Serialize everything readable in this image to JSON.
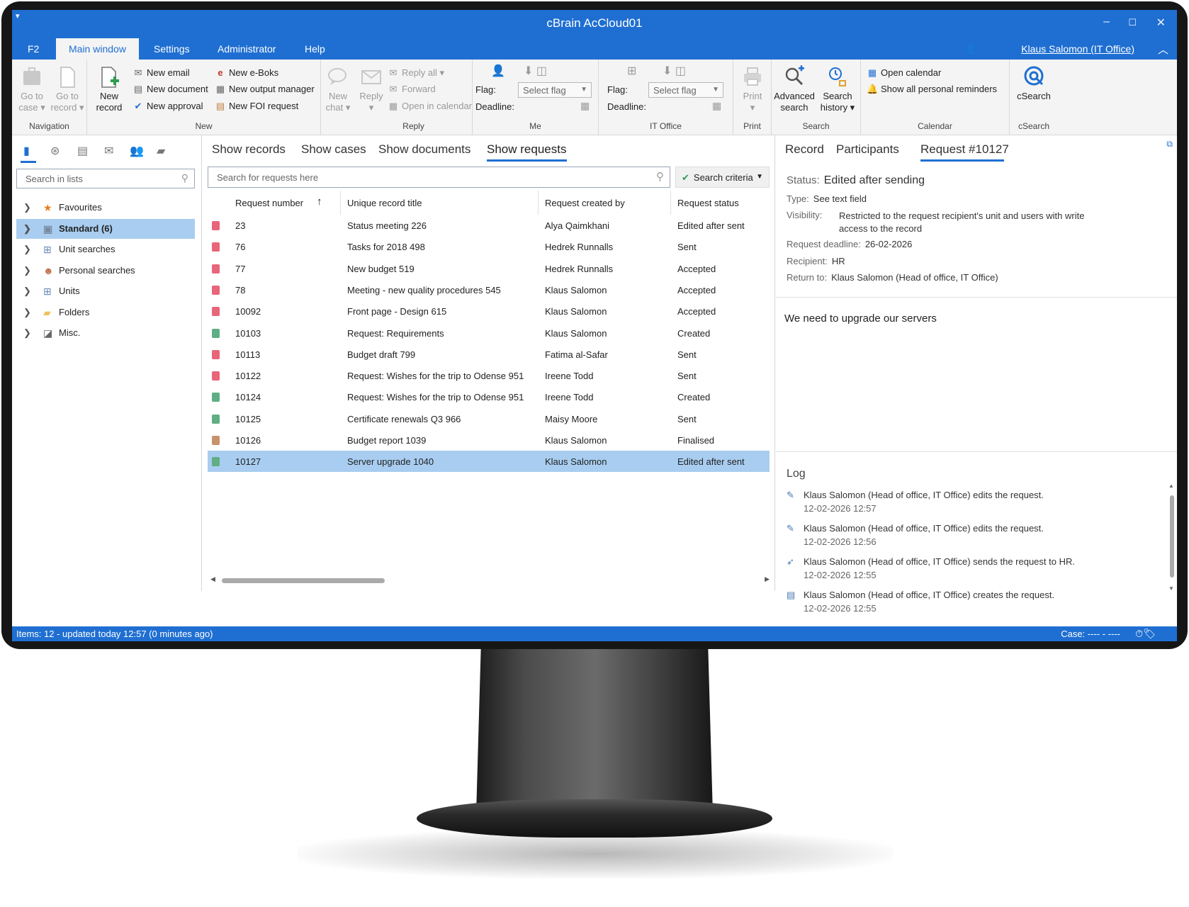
{
  "window": {
    "title": "cBrain AcCloud01",
    "minimize": "–",
    "maximize": "☐",
    "close": "✕",
    "quick_access": "▾"
  },
  "menu": {
    "tabs": [
      "F2",
      "Main window",
      "Settings",
      "Administrator",
      "Help"
    ],
    "user": "Klaus Salomon (IT Office)"
  },
  "ribbon": {
    "navigation": {
      "label": "Navigation",
      "goto_case": [
        "Go to",
        "case ▾"
      ],
      "goto_record": [
        "Go to",
        "record ▾"
      ]
    },
    "new": {
      "label": "New",
      "new_record": [
        "New",
        "record"
      ],
      "new_email": "New email",
      "new_document": "New document",
      "new_approval": "New approval",
      "new_eboks": "New e-Boks",
      "new_output_manager": "New output manager",
      "new_foi_request": "New FOI request",
      "new_chat": [
        "New",
        "chat ▾"
      ]
    },
    "reply": {
      "label": "Reply",
      "reply": [
        "Reply",
        "▾"
      ],
      "reply_all": "Reply all ▾",
      "forward": "Forward",
      "open_in_calendar": "Open in calendar"
    },
    "me": {
      "label": "Me",
      "flag_label": "Flag:",
      "flag_value": "Select flag",
      "deadline_label": "Deadline:"
    },
    "it_office": {
      "label": "IT Office",
      "flag_label": "Flag:",
      "flag_value": "Select flag",
      "deadline_label": "Deadline:"
    },
    "print": {
      "label": "Print",
      "print": [
        "Print",
        "▾"
      ]
    },
    "search": {
      "label": "Search",
      "advanced": [
        "Advanced",
        "search"
      ],
      "history": [
        "Search",
        "history ▾"
      ]
    },
    "calendar": {
      "label": "Calendar",
      "open_calendar": "Open calendar",
      "reminders": "Show all personal reminders"
    },
    "csearch": {
      "label": "cSearch",
      "csearch": "cSearch"
    }
  },
  "left": {
    "search_placeholder": "Search in lists",
    "tree": [
      {
        "label": "Favourites",
        "icon": "★",
        "color": "#e67e22"
      },
      {
        "label": "Standard (6)",
        "icon": "▣",
        "color": "#7a8aa0"
      },
      {
        "label": "Unit searches",
        "icon": "⊞",
        "color": "#6b8ab5"
      },
      {
        "label": "Personal searches",
        "icon": "☻",
        "color": "#c0704a"
      },
      {
        "label": "Units",
        "icon": "⊞",
        "color": "#6b8ab5"
      },
      {
        "label": "Folders",
        "icon": "▰",
        "color": "#f0c060"
      },
      {
        "label": "Misc.",
        "icon": "◪",
        "color": "#666"
      }
    ]
  },
  "center": {
    "tabs": [
      "Show records",
      "Show cases",
      "Show documents",
      "Show requests"
    ],
    "search_placeholder": "Search for requests here",
    "search_criteria": "Search criteria",
    "columns": [
      "Request number",
      "Unique record title",
      "Request created by",
      "Request status"
    ],
    "sort_arrow": "↑",
    "rows": [
      {
        "num": "23",
        "title": "Status meeting 226",
        "by": "Alya Qaimkhani",
        "status": "Edited after sent",
        "color": "#e8657a"
      },
      {
        "num": "76",
        "title": "Tasks for 2018 498",
        "by": "Hedrek Runnalls",
        "status": "Sent",
        "color": "#e8657a"
      },
      {
        "num": "77",
        "title": "New budget 519",
        "by": "Hedrek Runnalls",
        "status": "Accepted",
        "color": "#e8657a"
      },
      {
        "num": "78",
        "title": "Meeting - new quality procedures 545",
        "by": "Klaus Salomon",
        "status": "Accepted",
        "color": "#e8657a"
      },
      {
        "num": "10092",
        "title": "Front page - Design 615",
        "by": "Klaus Salomon",
        "status": "Accepted",
        "color": "#e8657a"
      },
      {
        "num": "10103",
        "title": "Request: Requirements",
        "by": "Klaus Salomon",
        "status": "Created",
        "color": "#5fae84"
      },
      {
        "num": "10113",
        "title": "Budget draft 799",
        "by": "Fatima al-Safar",
        "status": "Sent",
        "color": "#e8657a"
      },
      {
        "num": "10122",
        "title": "Request: Wishes for the trip to Odense 951",
        "by": "Ireene Todd",
        "status": "Sent",
        "color": "#e8657a"
      },
      {
        "num": "10124",
        "title": "Request: Wishes for the trip to Odense 951",
        "by": "Ireene Todd",
        "status": "Created",
        "color": "#5fae84"
      },
      {
        "num": "10125",
        "title": "Certificate renewals Q3 966",
        "by": "Maisy Moore",
        "status": "Sent",
        "color": "#5fae84"
      },
      {
        "num": "10126",
        "title": "Budget report 1039",
        "by": "Klaus Salomon",
        "status": "Finalised",
        "color": "#c8926a"
      },
      {
        "num": "10127",
        "title": "Server upgrade 1040",
        "by": "Klaus Salomon",
        "status": "Edited after sent",
        "color": "#5fae84"
      }
    ]
  },
  "right": {
    "tabs": [
      "Record",
      "Participants",
      "Request #10127"
    ],
    "status_label": "Status:",
    "status_value": "Edited after sending",
    "type_label": "Type:",
    "type_value": "See text field",
    "visibility_label": "Visibility:",
    "visibility_value": "Restricted to the request recipient's unit and users with write access to the record",
    "deadline_label": "Request deadline:",
    "deadline_value": "26-02-2026",
    "recipient_label": "Recipient:",
    "recipient_value": "HR",
    "return_label": "Return to:",
    "return_value": "Klaus Salomon (Head of office, IT Office)",
    "body": "We need to upgrade our servers",
    "log_title": "Log",
    "log": [
      {
        "icon": "✎",
        "text": "Klaus Salomon (Head of office, IT Office) edits the request.",
        "time": "12-02-2026 12:57"
      },
      {
        "icon": "✎",
        "text": "Klaus Salomon (Head of office, IT Office) edits the request.",
        "time": "12-02-2026 12:56"
      },
      {
        "icon": "➶",
        "text": "Klaus Salomon (Head of office, IT Office) sends the request to HR.",
        "time": "12-02-2026 12:55"
      },
      {
        "icon": "▤",
        "text": "Klaus Salomon (Head of office, IT Office) creates the request.",
        "time": "12-02-2026 12:55"
      }
    ]
  },
  "statusbar": {
    "items": "Items: 12 - updated today 12:57 (0 minutes ago)",
    "case": "Case: ---- - ----"
  }
}
